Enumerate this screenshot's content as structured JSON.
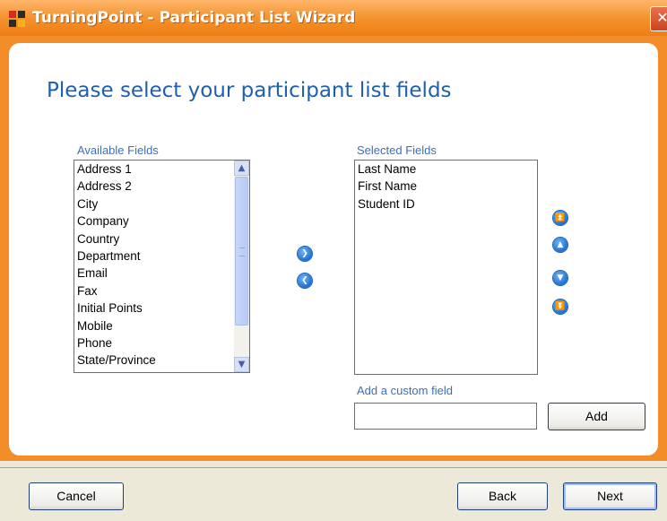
{
  "window": {
    "title": "TurningPoint - Participant List Wizard",
    "close_glyph": "✕",
    "accent_color": "#f28d2a",
    "icon": "turningpoint-app-icon"
  },
  "main": {
    "heading": "Please select your participant list fields",
    "available": {
      "label": "Available Fields",
      "items": [
        "Address 1",
        "Address 2",
        "City",
        "Company",
        "Country",
        "Department",
        "Email",
        "Fax",
        "Initial Points",
        "Mobile",
        "Phone",
        "State/Province"
      ]
    },
    "selected": {
      "label": "Selected Fields",
      "items": [
        "Last Name",
        "First Name",
        "Student ID"
      ]
    },
    "transfer": {
      "add_icon": "arrow-right-icon",
      "remove_icon": "arrow-left-icon"
    },
    "order": {
      "icons": [
        "move-top-icon",
        "move-up-icon",
        "move-down-icon",
        "move-bottom-icon"
      ]
    },
    "custom": {
      "label": "Add a custom field",
      "value": "",
      "add_button": "Add"
    }
  },
  "footer": {
    "cancel": "Cancel",
    "back": "Back",
    "next": "Next"
  }
}
